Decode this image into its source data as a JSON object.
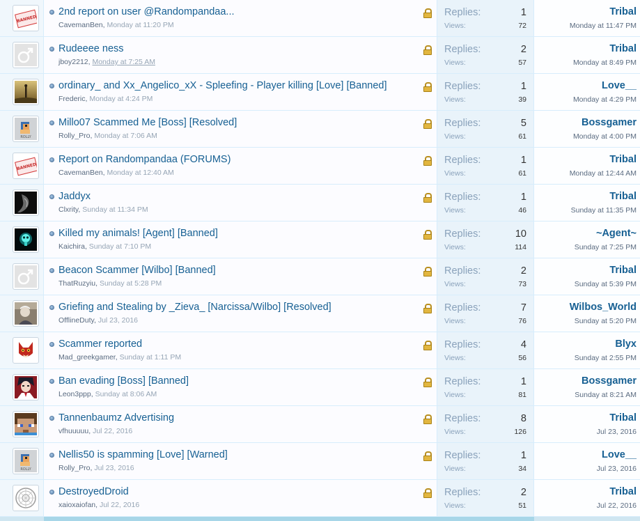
{
  "threads": [
    {
      "title": "2nd report on user @Randompandaa...",
      "author": "CavemanBen",
      "date": "Monday at 11:20 PM",
      "replies_label": "Replies:",
      "replies": "1",
      "views_label": "Views:",
      "views": "72",
      "last_user": "Tribal",
      "last_date": "Monday at 11:47 PM",
      "avatar_icon": "banned-stamp-icon"
    },
    {
      "title": "Rudeeee ness",
      "author": "jboy2212",
      "date": "Monday at 7:25 AM",
      "replies_label": "Replies:",
      "replies": "2",
      "views_label": "Views:",
      "views": "57",
      "last_user": "Tribal",
      "last_date": "Monday at 8:49 PM",
      "avatar_icon": "default-male-icon"
    },
    {
      "title": "ordinary_ and Xx_Angelico_xX - Spleefing - Player killing [Love] [Banned]",
      "author": "Frederic",
      "date": "Monday at 4:24 PM",
      "replies_label": "Replies:",
      "replies": "1",
      "views_label": "Views:",
      "views": "39",
      "last_user": "Love__",
      "last_date": "Monday at 4:29 PM",
      "avatar_icon": "figure-photo-icon"
    },
    {
      "title": "Millo07 Scammed Me [Boss] [Resolved]",
      "author": "Rolly_Pro",
      "date": "Monday at 7:06 AM",
      "replies_label": "Replies:",
      "replies": "5",
      "views_label": "Views:",
      "views": "61",
      "last_user": "Bossgamer",
      "last_date": "Monday at 4:00 PM",
      "avatar_icon": "rolly-bird-icon"
    },
    {
      "title": "Report on Randompandaa (FORUMS)",
      "author": "CavemanBen",
      "date": "Monday at 12:40 AM",
      "replies_label": "Replies:",
      "replies": "1",
      "views_label": "Views:",
      "views": "61",
      "last_user": "Tribal",
      "last_date": "Monday at 12:44 AM",
      "avatar_icon": "banned-stamp-icon"
    },
    {
      "title": "Jaddyx",
      "author": "Clxrity",
      "date": "Sunday at 11:34 PM",
      "replies_label": "Replies:",
      "replies": "1",
      "views_label": "Views:",
      "views": "46",
      "last_user": "Tribal",
      "last_date": "Sunday at 11:35 PM",
      "avatar_icon": "dark-creature-icon"
    },
    {
      "title": "Killed my animals! [Agent] [Banned]",
      "author": "Kaichira",
      "date": "Sunday at 7:10 PM",
      "replies_label": "Replies:",
      "replies": "10",
      "views_label": "Views:",
      "views": "114",
      "last_user": "~Agent~",
      "last_date": "Sunday at 7:25 PM",
      "avatar_icon": "glowing-skull-icon"
    },
    {
      "title": "Beacon Scammer [Wilbo] [Banned]",
      "author": "ThatRuzyiu",
      "date": "Sunday at 5:28 PM",
      "replies_label": "Replies:",
      "replies": "2",
      "views_label": "Views:",
      "views": "73",
      "last_user": "Tribal",
      "last_date": "Sunday at 5:39 PM",
      "avatar_icon": "default-male-icon"
    },
    {
      "title": "Griefing and Stealing by _Zieva_ [Narcissa/Wilbo] [Resolved]",
      "author": "OfflineDuty",
      "date": "Jul 23, 2016",
      "replies_label": "Replies:",
      "replies": "7",
      "views_label": "Views:",
      "views": "76",
      "last_user": "Wilbos_World",
      "last_date": "Sunday at 5:20 PM",
      "avatar_icon": "old-man-photo-icon"
    },
    {
      "title": "Scammer reported",
      "author": "Mad_greekgamer",
      "date": "Sunday at 1:11 PM",
      "replies_label": "Replies:",
      "replies": "4",
      "views_label": "Views:",
      "views": "56",
      "last_user": "Blyx",
      "last_date": "Sunday at 2:55 PM",
      "avatar_icon": "red-fox-icon"
    },
    {
      "title": "Ban evading [Boss] [Banned]",
      "author": "Leon3ppp",
      "date": "Sunday at 8:06 AM",
      "replies_label": "Replies:",
      "replies": "1",
      "views_label": "Views:",
      "views": "81",
      "last_user": "Bossgamer",
      "last_date": "Sunday at 8:21 AM",
      "avatar_icon": "anime-character-icon"
    },
    {
      "title": "Tannenbaumz Advertising",
      "author": "vfhuuuuu",
      "date": "Jul 22, 2016",
      "replies_label": "Replies:",
      "replies": "8",
      "views_label": "Views:",
      "views": "126",
      "last_user": "Tribal",
      "last_date": "Jul 23, 2016",
      "avatar_icon": "minecraft-head-icon"
    },
    {
      "title": "Nellis50 is spamming [Love] [Warned]",
      "author": "Rolly_Pro",
      "date": "Jul 23, 2016",
      "replies_label": "Replies:",
      "replies": "1",
      "views_label": "Views:",
      "views": "34",
      "last_user": "Love__",
      "last_date": "Jul 23, 2016",
      "avatar_icon": "rolly-bird-icon"
    },
    {
      "title": "DestroyedDroid",
      "author": "xaioxaiofan",
      "date": "Jul 22, 2016",
      "replies_label": "Replies:",
      "replies": "2",
      "views_label": "Views:",
      "views": "51",
      "last_user": "Tribal",
      "last_date": "Jul 22, 2016",
      "avatar_icon": "ornate-circle-icon"
    }
  ],
  "banned_stamp_text": "BANNED",
  "rolly_text": "ROLLY",
  "colors": {
    "link": "#176093",
    "row_border": "#d7edfc",
    "stats_bg": "#e9f3fa",
    "lock": "#e2b640"
  }
}
